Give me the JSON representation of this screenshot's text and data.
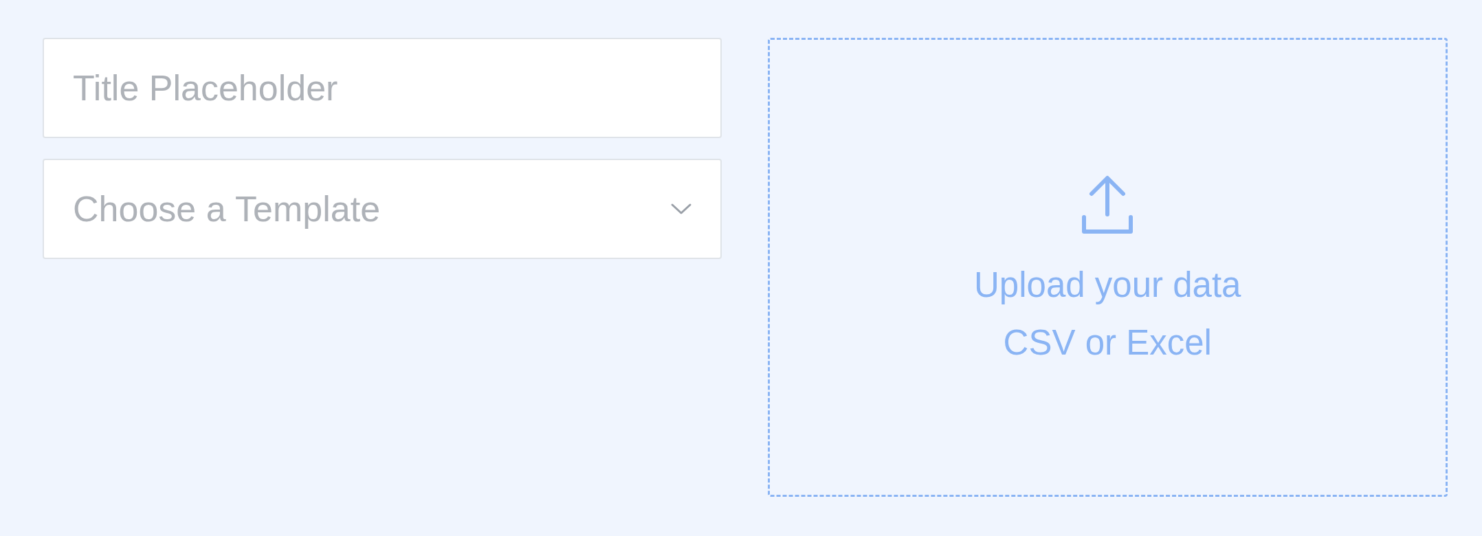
{
  "title_field": {
    "placeholder": "Title Placeholder"
  },
  "template_select": {
    "placeholder": "Choose a Template"
  },
  "upload": {
    "title": "Upload your data",
    "subtitle": "CSV or Excel"
  }
}
